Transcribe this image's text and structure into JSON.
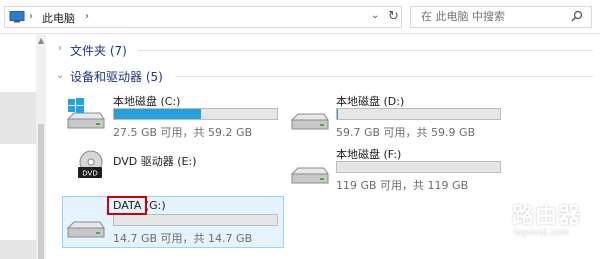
{
  "address_bar": {
    "location": "此电脑",
    "search_placeholder": "在 此电脑 中搜索"
  },
  "groups": {
    "folders": {
      "label": "文件夹 (7)"
    },
    "drives": {
      "label": "设备和驱动器 (5)"
    }
  },
  "drives": [
    {
      "name": "本地磁盘 (C:)",
      "size_text": "27.5 GB 可用，共 59.2 GB",
      "used_fraction": 0.535
    },
    {
      "name": "本地磁盘 (D:)",
      "size_text": "59.7 GB 可用，共 59.9 GB",
      "used_fraction": 0.003
    },
    {
      "name": "DVD 驱动器 (E:)"
    },
    {
      "name": "本地磁盘 (F:)",
      "size_text": "119 GB 可用，共 119 GB",
      "used_fraction": 0.0
    },
    {
      "name_label": "DATA",
      "name_suffix": " (G:)",
      "size_text": "14.7 GB 可用，共 14.7 GB",
      "used_fraction": 0.0
    }
  ],
  "dvd_badge": "DVD",
  "watermark": {
    "text": "路由器",
    "url": "luyouqi.com"
  },
  "colors": {
    "bar_fill": "#26a0da",
    "group_header": "#1e3287",
    "selection": "#e5f3ff",
    "highlight_box": "#d40000"
  }
}
